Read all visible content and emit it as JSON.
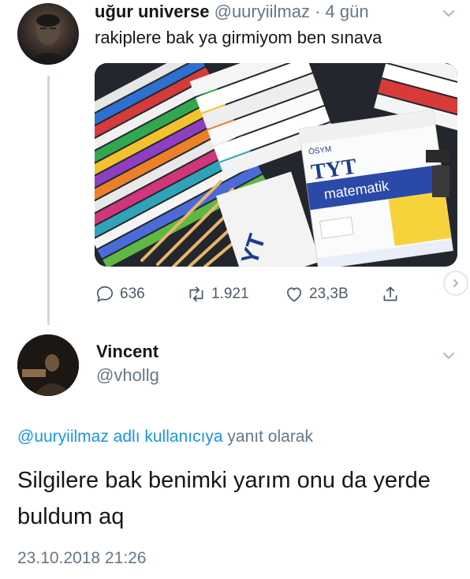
{
  "tweet": {
    "display_name": "uğur universe",
    "handle": "@uuryiilmaz",
    "separator": " · ",
    "age": "4 gün",
    "text": "rakiplere bak ya girmiyom ben sınava",
    "media_labels": {
      "brand": "ÖSYM",
      "book_title": "TYT",
      "book_subject": "matematik",
      "spine": "YT"
    },
    "stats": {
      "replies": "636",
      "retweets": "1.921",
      "likes": "23,3B"
    }
  },
  "reply": {
    "display_name": "Vincent",
    "handle": "@vhollg",
    "replying_to_mention": "@uuryiilmaz adlı kullanıcıya",
    "replying_to_rest": " yanıt olarak",
    "text": "Silgilere bak benimki yarım onu da yerde buldum aq",
    "timestamp": "23.10.2018 21:26"
  },
  "colors": {
    "link": "#1b95e0",
    "secondary_text": "#657786",
    "thread_line": "#cfd9de"
  }
}
